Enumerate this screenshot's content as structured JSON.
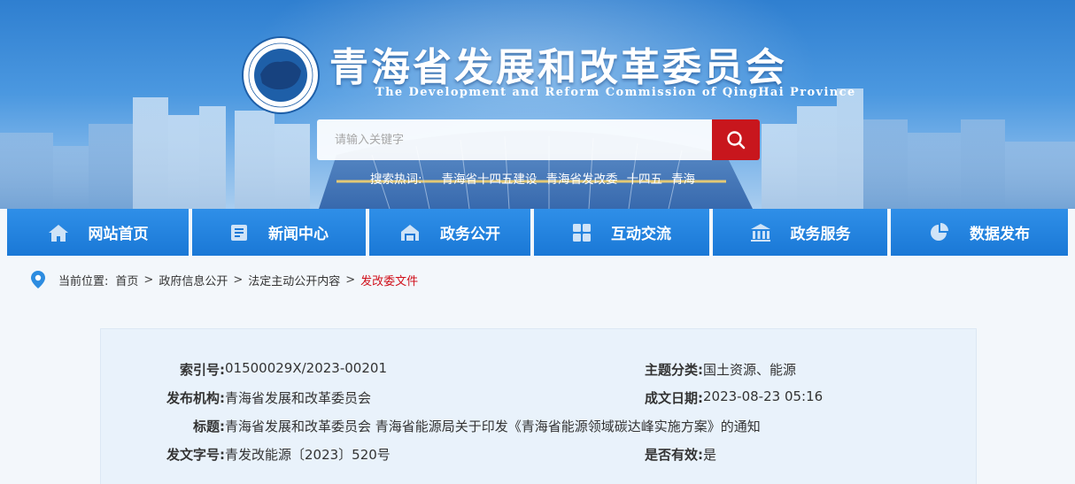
{
  "header": {
    "title": "青海省发展和改革委员会",
    "subtitle": "The Development and Reform Commission of QingHai Province",
    "logo_icon": "emblem-icon"
  },
  "search": {
    "placeholder": "请输入关键字",
    "button_icon": "search-icon",
    "hotwords_label": "搜索热词:",
    "hotwords": [
      "青海省十四五建设",
      "青海省发改委",
      "十四五",
      "青海"
    ]
  },
  "nav": {
    "items": [
      {
        "label": "网站首页",
        "icon": "home-icon"
      },
      {
        "label": "新闻中心",
        "icon": "news-icon"
      },
      {
        "label": "政务公开",
        "icon": "open-gov-icon"
      },
      {
        "label": "互动交流",
        "icon": "grid-icon"
      },
      {
        "label": "政务服务",
        "icon": "building-icon"
      },
      {
        "label": "数据发布",
        "icon": "pie-chart-icon"
      }
    ]
  },
  "breadcrumb": {
    "label": "当前位置:",
    "items": [
      "首页",
      "政府信息公开",
      "法定主动公开内容",
      "发改委文件"
    ],
    "separator": ">"
  },
  "info": {
    "index_label": "索引号:",
    "index_value": "01500029X/2023-00201",
    "topic_label": "主题分类:",
    "topic_value": "国土资源、能源",
    "publisher_label": "发布机构:",
    "publisher_value": "青海省发展和改革委员会",
    "date_label": "成文日期:",
    "date_value": "2023-08-23 05:16",
    "title_label": "标题:",
    "title_value": "青海省发展和改革委员会 青海省能源局关于印发《青海省能源领域碳达峰实施方案》的通知",
    "docno_label": "发文字号:",
    "docno_value": "青发改能源〔2023〕520号",
    "valid_label": "是否有效:",
    "valid_value": "是"
  },
  "colors": {
    "nav_blue": "#1a78d6",
    "search_red": "#c8161d",
    "current_crumb": "#d0101b"
  }
}
